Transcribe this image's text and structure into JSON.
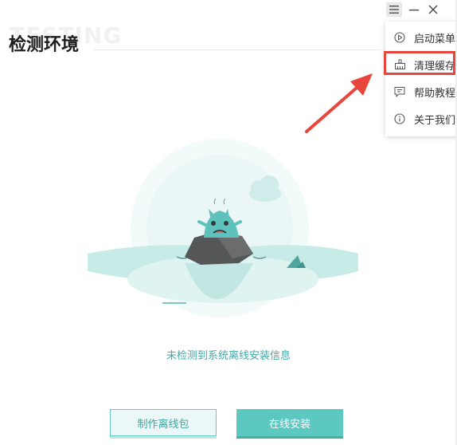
{
  "window": {
    "watermark": "TESTING",
    "controls": {
      "menu_icon": "hamburger-icon",
      "minimize_icon": "minimize-icon",
      "close_icon": "close-icon"
    }
  },
  "page": {
    "title": "检测环境"
  },
  "menu": {
    "items": [
      {
        "label": "启动菜单",
        "icon": "play-circle-icon"
      },
      {
        "label": "清理缓存",
        "icon": "broom-icon"
      },
      {
        "label": "帮助教程",
        "icon": "chat-icon"
      },
      {
        "label": "关于我们",
        "icon": "info-icon"
      }
    ],
    "highlighted_index": 1
  },
  "status": {
    "message": "未检测到系统离线安装信息"
  },
  "actions": {
    "make_offline_label": "制作离线包",
    "online_install_label": "在线安装"
  },
  "colors": {
    "accent": "#5cc8c0",
    "accent_text": "#43a9a6",
    "highlight_border": "#e8453c"
  }
}
